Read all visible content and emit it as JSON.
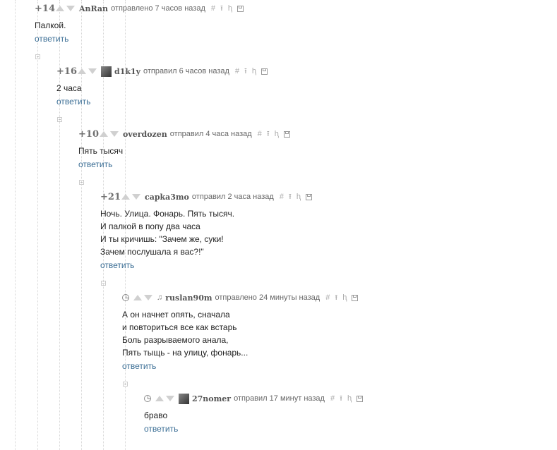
{
  "actions": {
    "reply_label": "ответить"
  },
  "icons": {
    "hash": "#",
    "link": "link-arrow-icon",
    "tree": "tree-icon",
    "save": "save-icon",
    "collapse": "collapse-minus-icon",
    "time": "clock-icon"
  },
  "comments": [
    {
      "rating": "+14",
      "author": "AnRan",
      "time": "отправлено 7 часов назад",
      "text": "Палкой."
    },
    {
      "rating": "+16",
      "author": "d1k1y",
      "time": "отправил 6 часов назад",
      "text": "2 часа"
    },
    {
      "rating": "+10",
      "author": "overdozen",
      "time": "отправил 4 часа назад",
      "text": "Пять тысяч"
    },
    {
      "rating": "+21",
      "author": "capka3mo",
      "time": "отправил 2 часа назад",
      "text": "Ночь. Улица. Фонарь. Пять тысяч.\nИ палкой в попу два часа\nИ ты кричишь: \"Зачем же, суки!\nЗачем послушала я вас?!\""
    },
    {
      "rating": "",
      "author": "ruslan90m",
      "time": "отправлено 24 минуты назад",
      "text": "А он начнет опять, сначала\nи повториться все как встарь\nБоль разрываемого анала,\nПять тыщь - на улицу, фонарь..."
    },
    {
      "rating": "",
      "author": "27nomer",
      "time": "отправил 17 минут назад",
      "text": "браво"
    }
  ]
}
